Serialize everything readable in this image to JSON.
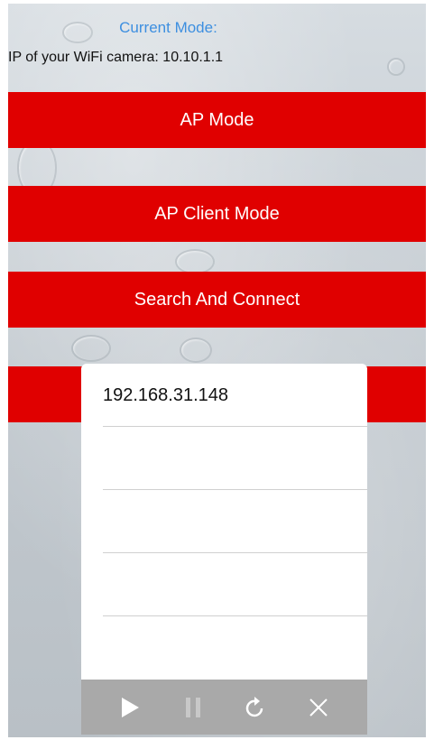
{
  "header": {
    "current_mode_label": "Current Mode:",
    "ip_label": "IP of your WiFi camera: 10.10.1.1"
  },
  "buttons": {
    "ap_mode": "AP Mode",
    "ap_client_mode": "AP Client Mode",
    "search_and_connect": "Search And Connect"
  },
  "popup": {
    "items": [
      "192.168.31.148",
      "",
      "",
      "",
      ""
    ]
  },
  "toolbar": {
    "icons": [
      "play-icon",
      "pause-icon",
      "refresh-icon",
      "close-icon"
    ]
  },
  "colors": {
    "accent_red": "#e00000",
    "mode_label_blue": "#3d8fe0",
    "toolbar_gray": "#a9a9a9"
  }
}
